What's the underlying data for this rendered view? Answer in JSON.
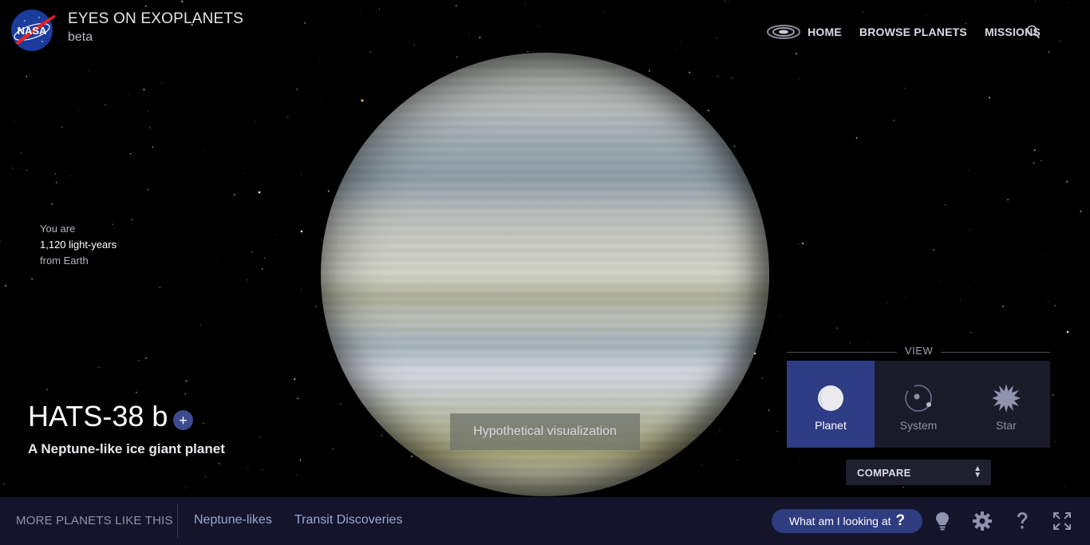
{
  "header": {
    "logo_text": "NASA",
    "app_title": "EYES ON EXOPLANETS",
    "app_subtitle": "beta",
    "nav": [
      {
        "label": "HOME",
        "icon": "galaxy-icon"
      },
      {
        "label": "BROWSE PLANETS"
      },
      {
        "label": "MISSIONS"
      }
    ],
    "search_icon": "search-icon"
  },
  "distance": {
    "line1": "You are",
    "line2": "1,120 light-years",
    "line3": "from Earth"
  },
  "planet": {
    "name": "HATS-38 b",
    "add_button": "+",
    "description": "A Neptune-like ice giant planet",
    "visualization_label": "Hypothetical visualization"
  },
  "view_panel": {
    "title": "VIEW",
    "options": [
      {
        "label": "Planet",
        "icon": "planet-icon",
        "active": true
      },
      {
        "label": "System",
        "icon": "system-icon",
        "active": false
      },
      {
        "label": "Star",
        "icon": "star-icon",
        "active": false
      }
    ],
    "compare_label": "COMPARE"
  },
  "bottom_bar": {
    "more_label": "MORE PLANETS LIKE THIS",
    "links": [
      "Neptune-likes",
      "Transit Discoveries"
    ],
    "what_am_i_label": "What am I looking at",
    "what_am_i_glyph": "?",
    "icons": [
      "lightbulb-icon",
      "gear-icon",
      "help-icon",
      "fullscreen-icon"
    ]
  },
  "colors": {
    "accent": "#2e3c86",
    "bottom_bar": "#14152a",
    "link": "#9ba6d6"
  }
}
